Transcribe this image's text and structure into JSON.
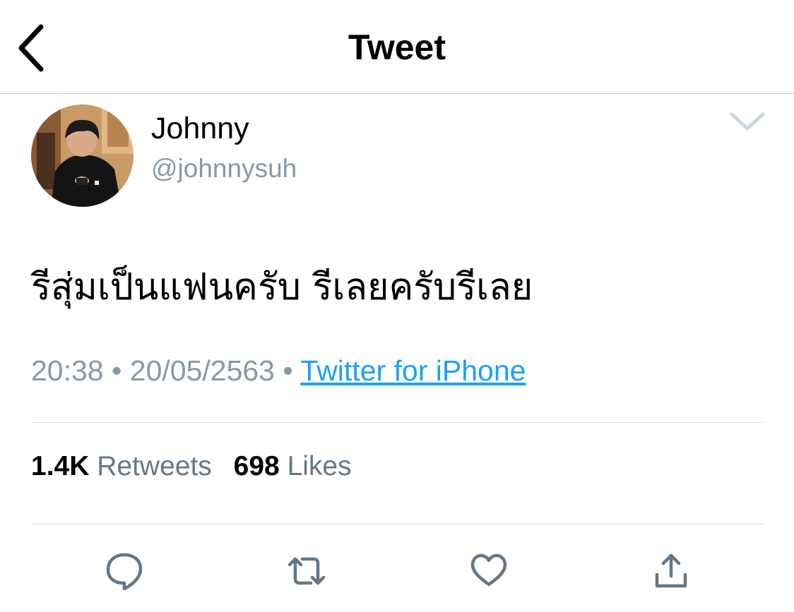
{
  "header": {
    "title": "Tweet",
    "back_icon": "chevron-left-icon"
  },
  "author": {
    "name": "Johnny",
    "handle": "@johnnysuh"
  },
  "tweet": {
    "text": "รีสุ่มเป็นแฟนครับ รีเลยครับรีเลย",
    "time": "20:38",
    "date": "20/05/2563",
    "separator": "•",
    "source": "Twitter for iPhone"
  },
  "stats": {
    "retweets_count": "1.4K",
    "retweets_label": "Retweets",
    "likes_count": "698",
    "likes_label": "Likes"
  },
  "actions": {
    "icons": [
      "reply-icon",
      "retweet-icon",
      "like-icon",
      "share-icon"
    ]
  },
  "colors": {
    "accent": "#1da1f2",
    "secondary_text": "#8899a6",
    "action_icon": "#657786"
  }
}
